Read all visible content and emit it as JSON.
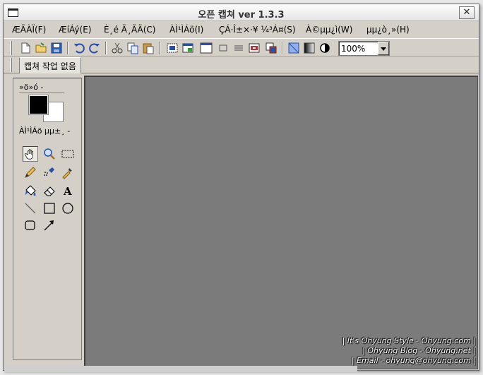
{
  "window": {
    "title": "오픈 캡쳐 ver 1.3.3",
    "close_label": "✕"
  },
  "menu": [
    "ÆÄÀÏ(F)",
    "ÆíÁý(E)",
    "È­¸é Ä¸ÃÄ(C)",
    "ÀÌ¹ÌÁö(I)",
    "ÇÁ·Î±×·¥ ¼³Á¤(S)",
    "À©µµ¿ì(W)",
    "µµ¿ò¸»(H)"
  ],
  "toolbar": {
    "zoom_value": "100%"
  },
  "tabs": {
    "active_label": "캡쳐 작업 없음"
  },
  "panel": {
    "color_label": "»ö»ó -",
    "tool_label": "ÀÌ¹ÌÁö µµ±¸ -",
    "foreground_color": "#000000",
    "background_color": "#ffffff"
  },
  "watermark": {
    "line1": "| It's Ohyung Style - Ohyung.com |",
    "line2": "| Ohyung Blog - Ohyung.net |",
    "line3": "| Email - ohyung@ohyung.com |"
  },
  "colors": {
    "canvas": "#7b7b7b",
    "chrome": "#d4d0c8"
  }
}
